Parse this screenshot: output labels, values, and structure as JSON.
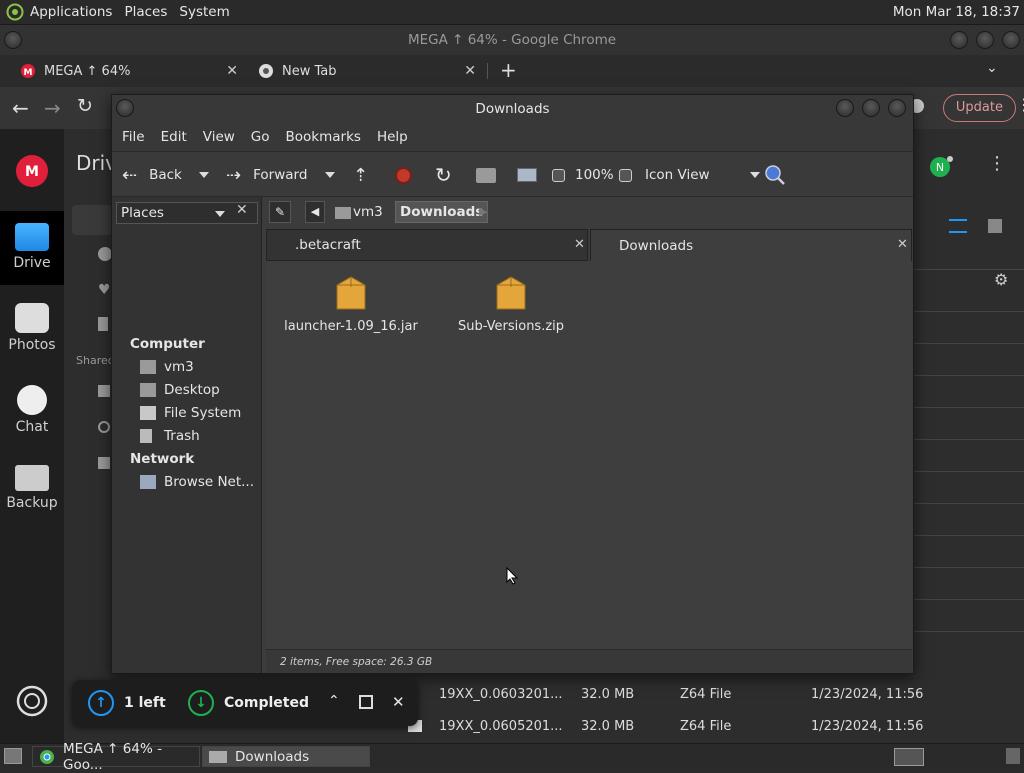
{
  "top_panel": {
    "menus": [
      "Applications",
      "Places",
      "System"
    ],
    "clock": "Mon Mar 18, 18:37"
  },
  "chrome": {
    "window_title": "MEGA ↑ 64% - Google Chrome",
    "tabs": [
      {
        "label": "MEGA ↑ 64%"
      },
      {
        "label": "New Tab"
      }
    ],
    "update_label": "Update",
    "avatar_letter": "N"
  },
  "mega": {
    "page_title": "Driv",
    "rail": [
      {
        "label": "Drive"
      },
      {
        "label": "Photos"
      },
      {
        "label": "Chat"
      },
      {
        "label": "Backup"
      }
    ],
    "shared_label": "Shared",
    "rows": [
      {
        "name": "19XX_0.0603201...",
        "size": "32.0 MB",
        "type": "Z64 File",
        "date": "1/23/2024, 11:56"
      },
      {
        "name": "19XX_0.0605201...",
        "size": "32.0 MB",
        "type": "Z64 File",
        "date": "1/23/2024, 11:56"
      }
    ],
    "toast": {
      "left_label": "1 left",
      "completed_label": "Completed"
    }
  },
  "caja": {
    "window_title": "Downloads",
    "menu": [
      "File",
      "Edit",
      "View",
      "Go",
      "Bookmarks",
      "Help"
    ],
    "toolbar": {
      "back": "Back",
      "forward": "Forward",
      "zoom": "100%",
      "view_mode": "Icon View"
    },
    "sidebar": {
      "header": "Places",
      "sections": [
        {
          "title": "Computer",
          "items": [
            "vm3",
            "Desktop",
            "File System",
            "Trash"
          ]
        },
        {
          "title": "Network",
          "items": [
            "Browse Net..."
          ]
        }
      ]
    },
    "path": [
      "vm3",
      "Downloads"
    ],
    "tabs": [
      ".betacraft",
      "Downloads"
    ],
    "files": [
      {
        "name": "launcher-1.09_16.jar"
      },
      {
        "name": "Sub-Versions.zip"
      }
    ],
    "status": "2 items, Free space: 26.3 GB"
  },
  "taskbar": {
    "tasks": [
      "MEGA ↑ 64% - Goo...",
      "Downloads"
    ]
  },
  "colors": {
    "mega_red": "#e0203a",
    "mega_blue": "#2196f3",
    "accent_green": "#1fb14f",
    "folder_orange": "#e4a53a"
  }
}
